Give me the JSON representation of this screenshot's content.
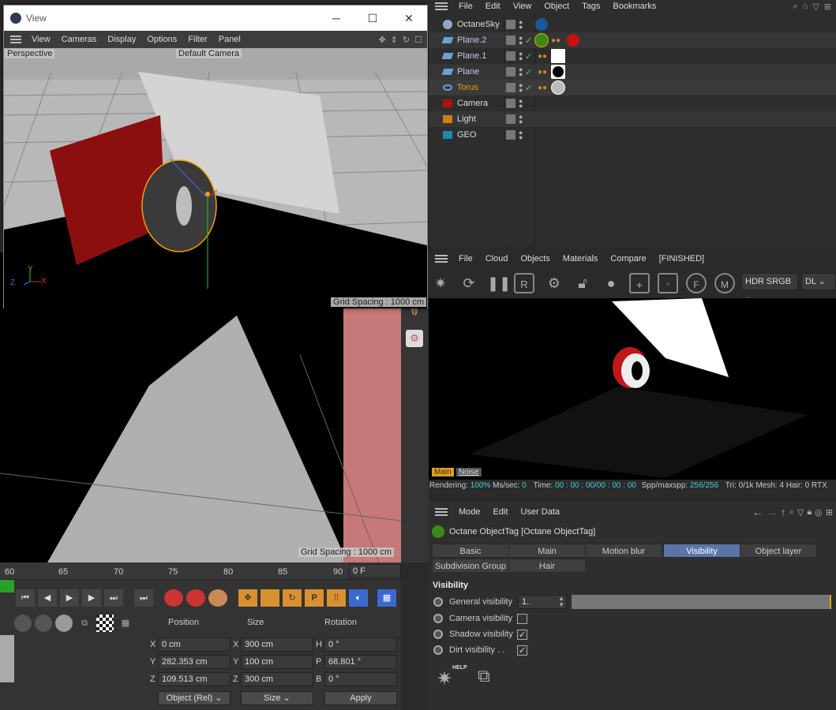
{
  "view_window": {
    "title": "View",
    "menu": [
      "View",
      "Cameras",
      "Display",
      "Options",
      "Filter",
      "Panel"
    ],
    "viewport_label": "Perspective",
    "camera_label": "Default Camera",
    "grid_spacing": "Grid Spacing : 1000 cm"
  },
  "main_viewport": {
    "grid_spacing": "Grid Spacing : 1000 cm"
  },
  "object_manager": {
    "menu": [
      "File",
      "Edit",
      "View",
      "Object",
      "Tags",
      "Bookmarks"
    ],
    "objects": [
      {
        "name": "OctaneSky"
      },
      {
        "name": "Plane.2"
      },
      {
        "name": "Plane.1"
      },
      {
        "name": "Plane"
      },
      {
        "name": "Torus"
      },
      {
        "name": "Camera"
      },
      {
        "name": "Light"
      },
      {
        "name": "GEO"
      }
    ]
  },
  "live_viewer": {
    "menu": [
      "File",
      "Cloud",
      "Objects",
      "Materials",
      "Compare",
      "[FINISHED]"
    ],
    "color_mode": "HDR SRGB",
    "kernel": "DL",
    "tabs": [
      "Main",
      "Noise"
    ],
    "status": {
      "rendering_label": "Rendering:",
      "rendering_value": "100%",
      "ms_label": "Ms/sec:",
      "ms_value": "0",
      "time_label": "Time:",
      "time_value": "00 : 00 : 00/00 : 00 : 00",
      "spp_label": "Spp/maxspp:",
      "spp_value": "256/256",
      "tri": "Tri: 0/1k",
      "mesh": "Mesh: 4",
      "hair": "Hair: 0",
      "rtx": "RTX"
    }
  },
  "attribute_manager": {
    "menu": [
      "Mode",
      "Edit",
      "User Data"
    ],
    "object_title": "Octane ObjectTag [Octane ObjectTag]",
    "tabs_row1": [
      "Basic",
      "Main",
      "Motion blur",
      "Visibility",
      "Object layer"
    ],
    "tabs_row2": [
      "Subdivision Group",
      "Hair"
    ],
    "active_tab": "Visibility",
    "section_title": "Visibility",
    "fields": {
      "general_visibility": {
        "label": "General visibility",
        "value": "1."
      },
      "camera_visibility": {
        "label": "Camera visibility",
        "checked": false
      },
      "shadow_visibility": {
        "label": "Shadow visibility",
        "checked": true
      },
      "dirt_visibility": {
        "label": "Dirt visibility . .",
        "checked": true
      }
    },
    "help_label": "HELP"
  },
  "timeline": {
    "ruler": [
      "60",
      "65",
      "70",
      "75",
      "80",
      "85",
      "90"
    ],
    "current_frame": "0 F"
  },
  "coordinates": {
    "headers": [
      "Position",
      "Size",
      "Rotation"
    ],
    "rows": [
      {
        "axis": "X",
        "pos": "0 cm",
        "size_axis": "X",
        "size": "300 cm",
        "rot_axis": "H",
        "rot": "0 °"
      },
      {
        "axis": "Y",
        "pos": "282.353 cm",
        "size_axis": "Y",
        "size": "100 cm",
        "rot_axis": "P",
        "rot": "68.801 °"
      },
      {
        "axis": "Z",
        "pos": "109.513 cm",
        "size_axis": "Z",
        "size": "300 cm",
        "rot_axis": "B",
        "rot": "0 °"
      }
    ],
    "mode": "Object (Rel)",
    "size_mode": "Size",
    "apply": "Apply"
  },
  "colors": {
    "accent": "#5b74a8",
    "selection": "#f0a000",
    "plane_red": "#8b0f0f"
  }
}
